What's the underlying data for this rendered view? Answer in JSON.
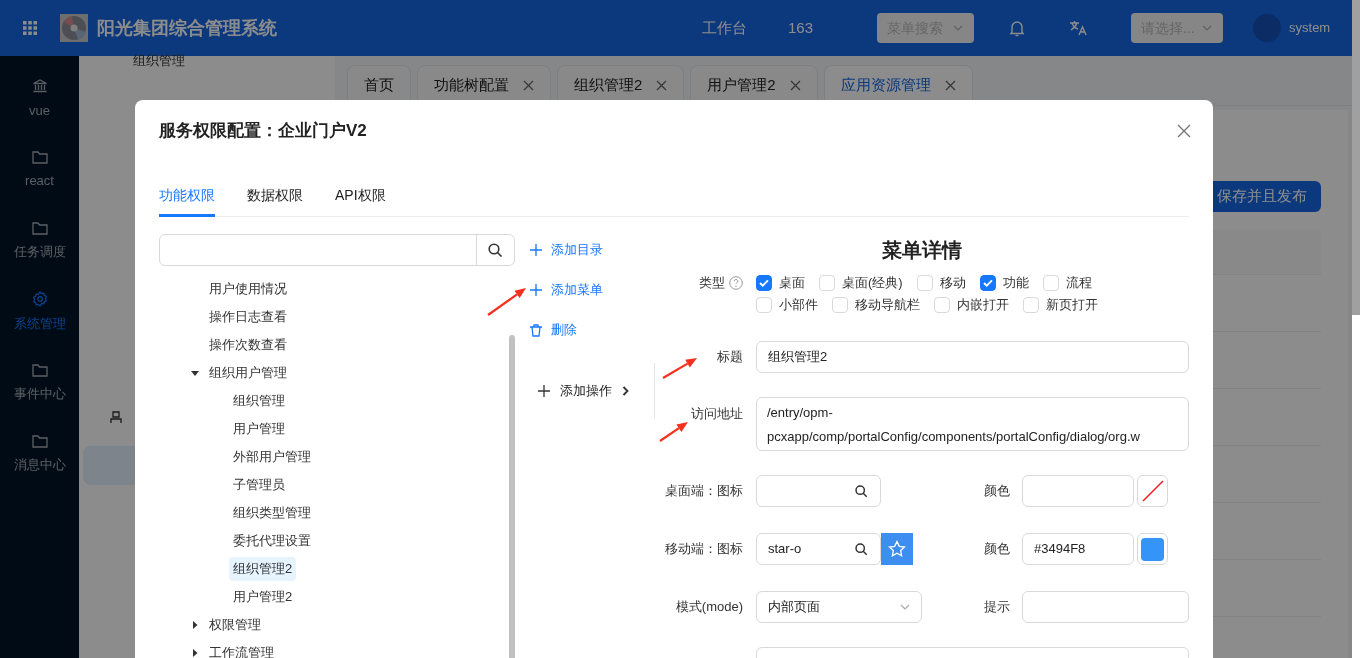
{
  "header": {
    "title": "阳光集团综合管理系统",
    "workbench": "工作台",
    "count": "163",
    "menu_search": {
      "placeholder": "菜单搜索"
    },
    "select": {
      "placeholder": "请选择..."
    },
    "user": "system"
  },
  "sidebar": {
    "items": [
      {
        "label": "vue",
        "selected": false
      },
      {
        "label": "react",
        "selected": false
      },
      {
        "label": "任务调度",
        "selected": false
      },
      {
        "label": "系统管理",
        "selected": true
      },
      {
        "label": "事件中心",
        "selected": false
      },
      {
        "label": "消息中心",
        "selected": false
      }
    ]
  },
  "submenu": {
    "items": [
      {
        "label": "组织管理"
      }
    ]
  },
  "tabs": [
    {
      "label": "首页",
      "closable": false,
      "selected": false
    },
    {
      "label": "功能树配置",
      "closable": true,
      "selected": false
    },
    {
      "label": "组织管理2",
      "closable": true,
      "selected": false
    },
    {
      "label": "用户管理2",
      "closable": true,
      "selected": false
    },
    {
      "label": "应用资源管理",
      "closable": true,
      "selected": true
    }
  ],
  "publish_button": "保存并且发布",
  "dialog": {
    "title": "服务权限配置：企业门户V2",
    "tabs": [
      {
        "label": "功能权限",
        "selected": true
      },
      {
        "label": "数据权限",
        "selected": false
      },
      {
        "label": "API权限",
        "selected": false
      }
    ],
    "tree": [
      {
        "label": "用户使用情况",
        "selected": false
      },
      {
        "label": "操作日志查看",
        "selected": false
      },
      {
        "label": "操作次数查看",
        "selected": false
      },
      {
        "label": "组织用户管理",
        "selected": false,
        "expanded": true,
        "children": [
          {
            "label": "组织管理",
            "selected": false
          },
          {
            "label": "用户管理",
            "selected": false
          },
          {
            "label": "外部用户管理",
            "selected": false
          },
          {
            "label": "子管理员",
            "selected": false
          },
          {
            "label": "组织类型管理",
            "selected": false
          },
          {
            "label": "委托代理设置",
            "selected": false
          },
          {
            "label": "组织管理2",
            "selected": true
          },
          {
            "label": "用户管理2",
            "selected": false
          }
        ]
      },
      {
        "label": "权限管理",
        "selected": false,
        "expanded": false
      },
      {
        "label": "工作流管理",
        "selected": false,
        "expanded": false
      }
    ],
    "actions": [
      {
        "label": "添加目录",
        "kind": "add"
      },
      {
        "label": "添加菜单",
        "kind": "add"
      },
      {
        "label": "删除",
        "kind": "delete"
      },
      {
        "label": "添加操作",
        "kind": "submenu"
      }
    ],
    "detail": {
      "title": "菜单详情",
      "type": {
        "label": "类型",
        "options": [
          {
            "label": "桌面",
            "checked": true
          },
          {
            "label": "桌面(经典)",
            "checked": false
          },
          {
            "label": "移动",
            "checked": false
          },
          {
            "label": "功能",
            "checked": true
          },
          {
            "label": "流程",
            "checked": false
          },
          {
            "label": "小部件",
            "checked": false
          },
          {
            "label": "移动导航栏",
            "checked": false
          },
          {
            "label": "内嵌打开",
            "checked": false
          },
          {
            "label": "新页打开",
            "checked": false
          }
        ]
      },
      "title_field": {
        "label": "标题",
        "value": "组织管理2"
      },
      "url": {
        "label": "访问地址",
        "value": "/entry/opm-pcxapp/comp/portalConfig/components/portalConfig/dialog/org.w"
      },
      "desktop_icon": {
        "label": "桌面端：图标"
      },
      "desktop_color": {
        "label": "颜色"
      },
      "mobile_icon": {
        "label": "移动端：图标",
        "value": "star-o"
      },
      "mobile_color": {
        "label": "颜色",
        "value": "#3494F8"
      },
      "mode": {
        "label": "模式(mode)",
        "value": "内部页面"
      },
      "hint": {
        "label": "提示"
      }
    },
    "annotations": [
      {
        "kind": "arrow"
      },
      {
        "kind": "arrow"
      },
      {
        "kind": "arrow"
      }
    ]
  }
}
